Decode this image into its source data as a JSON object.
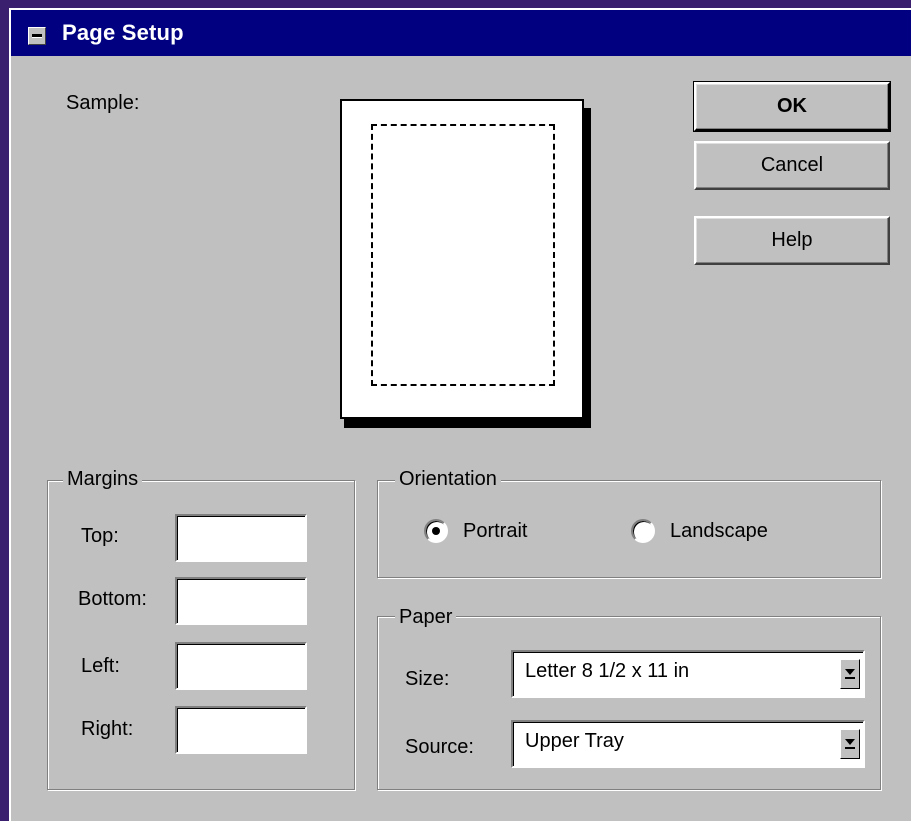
{
  "window": {
    "title": "Page Setup",
    "system_menu_icon": "system-menu-icon"
  },
  "sample": {
    "label": "Sample:"
  },
  "buttons": {
    "ok": "OK",
    "cancel": "Cancel",
    "help": "Help"
  },
  "margins": {
    "group_label": "Margins",
    "top_label": "Top:",
    "bottom_label": "Bottom:",
    "left_label": "Left:",
    "right_label": "Right:",
    "top_value": "",
    "bottom_value": "",
    "left_value": "",
    "right_value": ""
  },
  "orientation": {
    "group_label": "Orientation",
    "portrait_label": "Portrait",
    "landscape_label": "Landscape",
    "selected": "portrait"
  },
  "paper": {
    "group_label": "Paper",
    "size_label": "Size:",
    "size_value": "Letter 8 1/2 x 11 in",
    "source_label": "Source:",
    "source_value": "Upper Tray"
  },
  "colors": {
    "desktop": "#3a1f6e",
    "titlebar": "#000080",
    "face": "#c0c0c0"
  }
}
